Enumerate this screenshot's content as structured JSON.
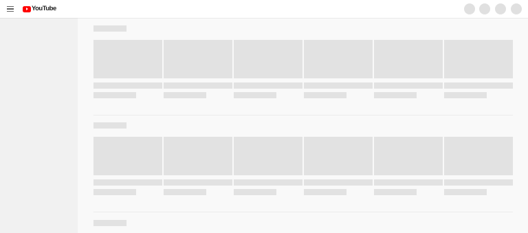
{
  "app": {
    "name": "YouTube",
    "brand_color": "#ff0000",
    "placeholder_color": "#e2e2e2",
    "state": "loading-skeleton"
  },
  "header": {
    "menu_icon": "hamburger-menu-icon",
    "logo_text": "YouTube",
    "right_controls": [
      "avatar-placeholder",
      "avatar-placeholder",
      "avatar-placeholder",
      "avatar-placeholder"
    ]
  },
  "sections": [
    {
      "card_count": 6
    },
    {
      "card_count": 6
    },
    {
      "card_count": 0
    }
  ]
}
